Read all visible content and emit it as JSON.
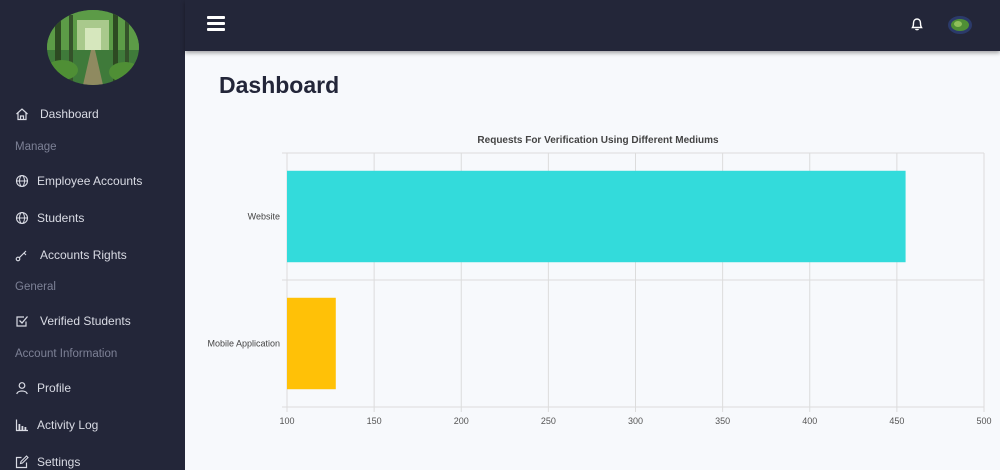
{
  "sidebar": {
    "items": [
      {
        "label": "Dashboard",
        "icon": "home-icon"
      },
      {
        "label": "Employee Accounts",
        "icon": "globe-icon"
      },
      {
        "label": "Students",
        "icon": "globe-icon"
      },
      {
        "label": "Accounts Rights",
        "icon": "key-icon"
      },
      {
        "label": "Verified Students",
        "icon": "checkbox-icon"
      },
      {
        "label": "Profile",
        "icon": "user-icon"
      },
      {
        "label": "Activity Log",
        "icon": "bar-chart-icon"
      },
      {
        "label": "Settings",
        "icon": "edit-icon"
      }
    ],
    "sections": {
      "manage": "Manage",
      "general": "General",
      "account_information": "Account Information"
    }
  },
  "topbar": {
    "menu_icon": "hamburger-icon",
    "notification_icon": "bell-icon",
    "avatar_icon": "avatar"
  },
  "main": {
    "title": "Dashboard"
  },
  "chart_data": {
    "type": "bar",
    "orientation": "horizontal",
    "title": "Requests For Verification Using Different Mediums",
    "categories": [
      "Website",
      "Mobile Application"
    ],
    "values": [
      455,
      128
    ],
    "colors": [
      "#33dbdb",
      "#ffc107"
    ],
    "xlim": [
      100,
      500
    ],
    "xticks": [
      100,
      150,
      200,
      250,
      300,
      350,
      400,
      450,
      500
    ],
    "xlabel": "",
    "ylabel": "",
    "grid": true,
    "legend": "none"
  }
}
